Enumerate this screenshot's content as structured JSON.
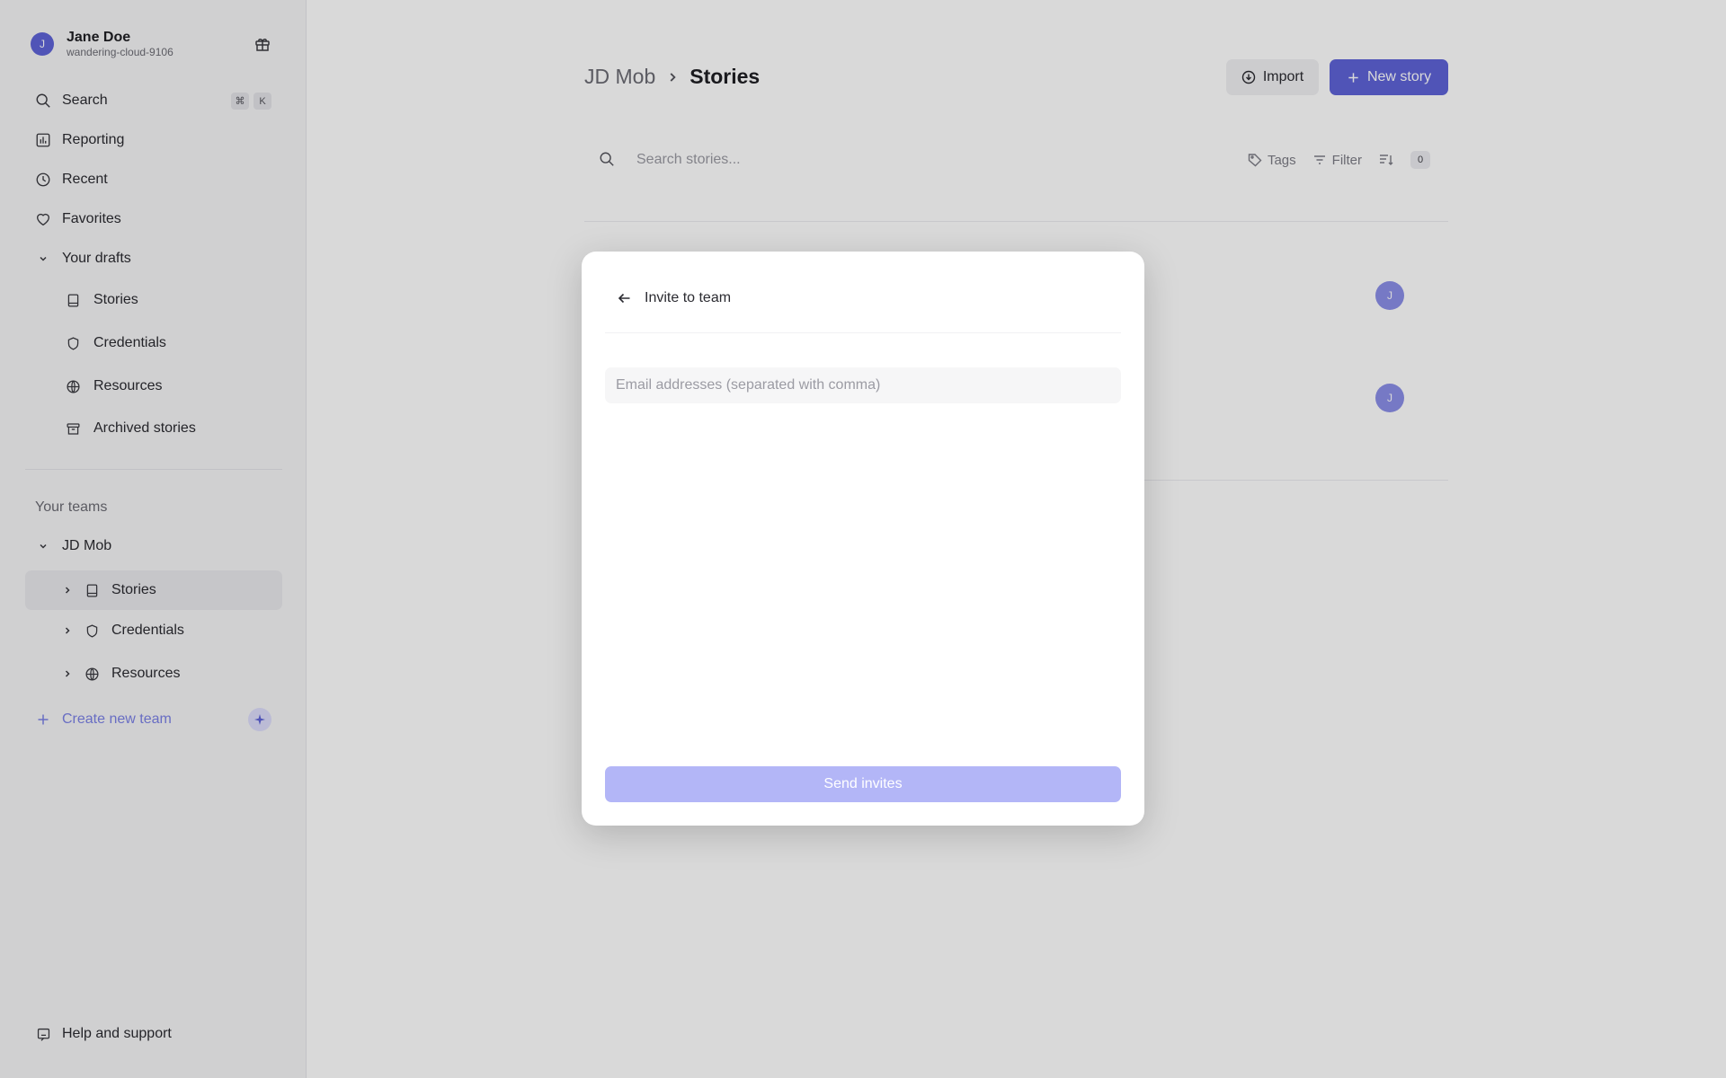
{
  "user": {
    "name": "Jane Doe",
    "handle": "wandering-cloud-9106",
    "initial": "J"
  },
  "sidebar": {
    "search": {
      "label": "Search",
      "shortcut_keys": [
        "⌘",
        "K"
      ]
    },
    "items": [
      {
        "label": "Reporting",
        "icon": "chart-icon"
      },
      {
        "label": "Recent",
        "icon": "clock-icon"
      },
      {
        "label": "Favorites",
        "icon": "heart-icon"
      }
    ],
    "drafts": {
      "label": "Your drafts",
      "items": [
        {
          "label": "Stories",
          "icon": "book-icon"
        },
        {
          "label": "Credentials",
          "icon": "shield-icon"
        },
        {
          "label": "Resources",
          "icon": "globe-icon"
        },
        {
          "label": "Archived stories",
          "icon": "archive-icon"
        }
      ]
    },
    "teams_label": "Your teams",
    "team": {
      "name": "JD Mob",
      "items": [
        {
          "label": "Stories",
          "icon": "book-icon"
        },
        {
          "label": "Credentials",
          "icon": "shield-icon"
        },
        {
          "label": "Resources",
          "icon": "globe-icon"
        }
      ]
    },
    "create_team_label": "Create new team",
    "help_label": "Help and support"
  },
  "header": {
    "team": "JD Mob",
    "page": "Stories",
    "import_label": "Import",
    "new_story_label": "New story"
  },
  "toolbar": {
    "search_placeholder": "Search stories...",
    "tags_label": "Tags",
    "filter_label": "Filter",
    "count": "0"
  },
  "rows": [
    {
      "avatar": "J"
    },
    {
      "avatar": "J"
    }
  ],
  "modal": {
    "title": "Invite to team",
    "email_placeholder": "Email addresses (separated with comma)",
    "email_value": "",
    "send_label": "Send invites"
  },
  "colors": {
    "accent": "#5e63d8",
    "accent_disabled": "#b3b6f7",
    "create_team": "#7b80e6"
  }
}
